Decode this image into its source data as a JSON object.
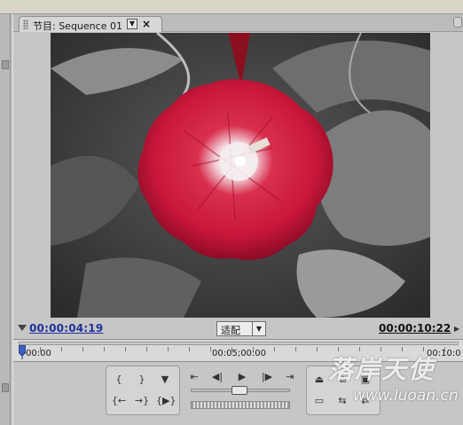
{
  "tab": {
    "title": "节目: Sequence 01",
    "menu_icon": "triangle-down-icon",
    "close_glyph": "×"
  },
  "monitor": {
    "current_timecode": "00:00:04:19",
    "fit_label": "适配",
    "duration_timecode": "00:00:10:22"
  },
  "ruler": {
    "labels": [
      "00:00",
      "00:05;00:00",
      "00:10:0"
    ]
  },
  "transport": {
    "marker_group_icons": [
      "mark-in-icon",
      "mark-out-icon",
      "set-marker-icon",
      "go-to-in-icon",
      "go-to-out-icon",
      "play-in-to-out-icon"
    ],
    "playback_icons": [
      "step-to-in-icon",
      "step-back-icon",
      "play-icon",
      "step-forward-icon",
      "step-to-out-icon"
    ],
    "edit_icons": [
      "lift-icon",
      "extract-icon",
      "export-frame-icon",
      "trim-icon",
      "overlay-icon",
      "insert-icon"
    ]
  },
  "watermark": {
    "chinese": "落岸天使",
    "url": "www.luoan.cn"
  },
  "colors": {
    "timecode_blue": "#1d2f9a",
    "flower_red": "#c9173a",
    "panel_gray": "#c6c6c6"
  }
}
